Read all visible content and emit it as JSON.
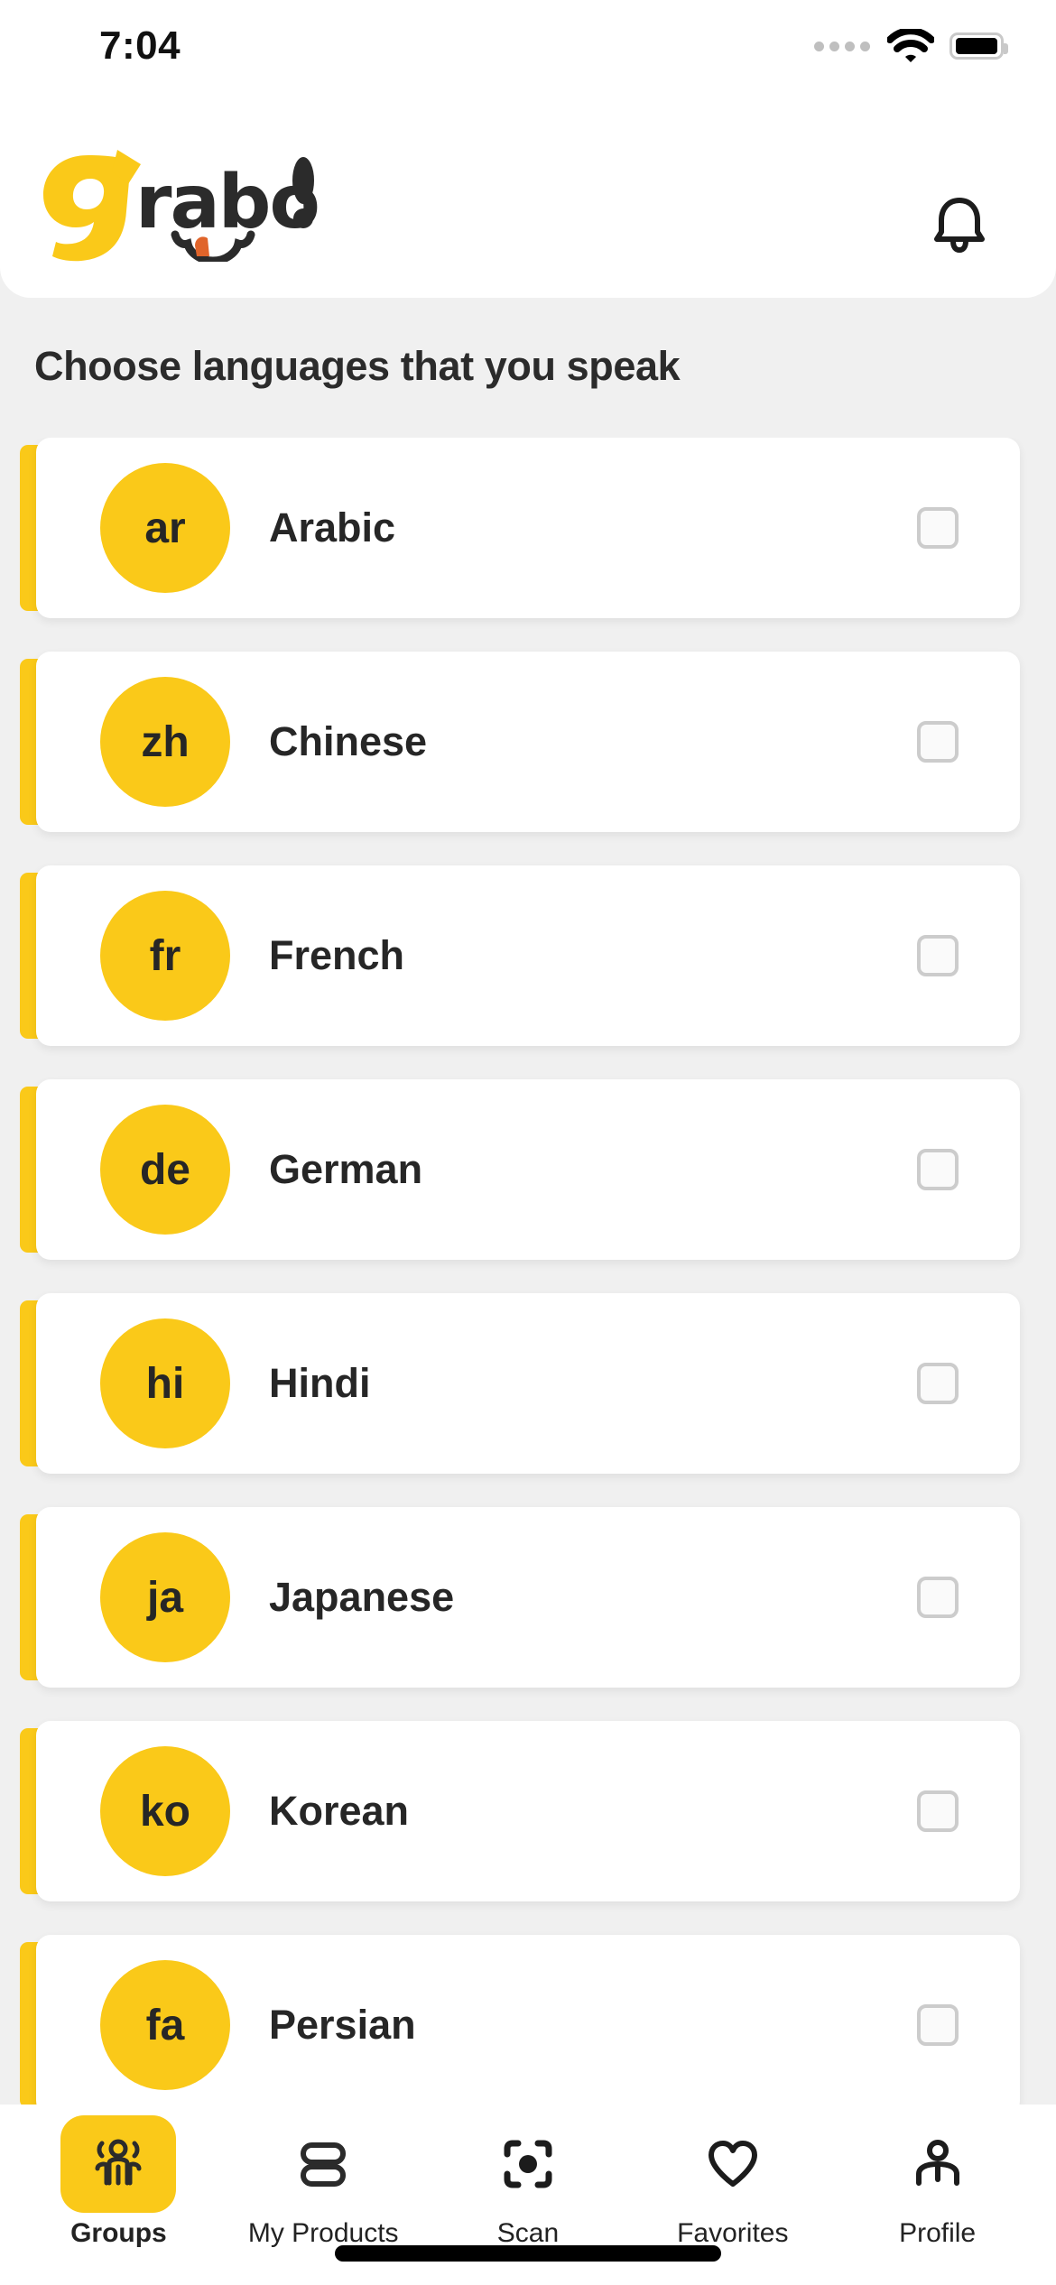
{
  "status_bar": {
    "time": "7:04",
    "signal_icon": "signal-dots-icon",
    "wifi_icon": "wifi-icon",
    "battery_icon": "battery-full-icon"
  },
  "header": {
    "logo_text": "Grabo!",
    "logo_first_letter": "g",
    "logo_rest": "rabo!",
    "notification_icon": "bell-icon"
  },
  "page": {
    "heading": "Choose languages that you speak"
  },
  "colors": {
    "brand_yellow": "#fac919",
    "background": "#f0f0f0",
    "card": "#ffffff",
    "text": "#262626",
    "checkbox_border": "#cccccc"
  },
  "languages": [
    {
      "code": "ar",
      "name": "Arabic",
      "checked": false
    },
    {
      "code": "zh",
      "name": "Chinese",
      "checked": false
    },
    {
      "code": "fr",
      "name": "French",
      "checked": false
    },
    {
      "code": "de",
      "name": "German",
      "checked": false
    },
    {
      "code": "hi",
      "name": "Hindi",
      "checked": false
    },
    {
      "code": "ja",
      "name": "Japanese",
      "checked": false
    },
    {
      "code": "ko",
      "name": "Korean",
      "checked": false
    },
    {
      "code": "fa",
      "name": "Persian",
      "checked": false
    }
  ],
  "bottom_nav": {
    "active_index": 0,
    "items": [
      {
        "label": "Groups",
        "icon": "group-people-icon"
      },
      {
        "label": "My Products",
        "icon": "stacked-pills-icon"
      },
      {
        "label": "Scan",
        "icon": "scan-viewfinder-icon"
      },
      {
        "label": "Favorites",
        "icon": "heart-icon"
      },
      {
        "label": "Profile",
        "icon": "person-icon"
      }
    ]
  }
}
